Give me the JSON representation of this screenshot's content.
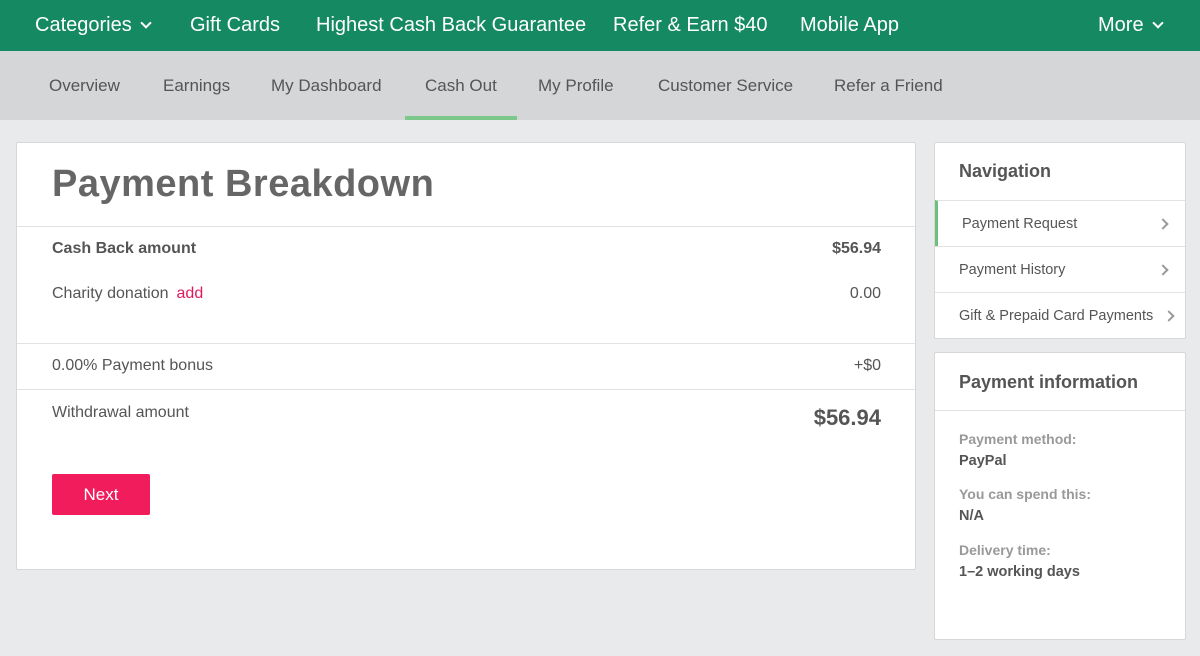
{
  "topnav": {
    "categories": "Categories",
    "gift_cards": "Gift Cards",
    "highest_cash_back": "Highest Cash Back Guarantee",
    "refer_earn": "Refer & Earn $40",
    "mobile_app": "Mobile App",
    "more": "More"
  },
  "subnav": {
    "overview": "Overview",
    "earnings": "Earnings",
    "dashboard": "My Dashboard",
    "cash_out": "Cash Out",
    "profile": "My Profile",
    "customer_service": "Customer Service",
    "refer_friend": "Refer a Friend",
    "active": "Cash Out"
  },
  "breakdown": {
    "title": "Payment Breakdown",
    "cash_back_label": "Cash Back amount",
    "cash_back_value": "$56.94",
    "charity_label": "Charity donation",
    "charity_link": "add",
    "charity_value": "0.00",
    "bonus_label": "0.00% Payment bonus",
    "bonus_value": "+$0",
    "withdrawal_label": "Withdrawal amount",
    "withdrawal_value": "$56.94",
    "next_label": "Next"
  },
  "navigation_panel": {
    "title": "Navigation",
    "items": [
      {
        "label": "Payment Request",
        "active": true
      },
      {
        "label": "Payment History",
        "active": false
      },
      {
        "label": "Gift & Prepaid Card Payments",
        "active": false
      }
    ]
  },
  "payment_info": {
    "title": "Payment information",
    "method_label": "Payment method:",
    "method_value": "PayPal",
    "spend_label": "You can spend this:",
    "spend_value": "N/A",
    "delivery_label": "Delivery time:",
    "delivery_value": "1–2 working days"
  },
  "colors": {
    "topbar": "#158a62",
    "subbar": "#d5d6d8",
    "accent_pink": "#f01c5c",
    "active_green": "#7cc78a"
  }
}
